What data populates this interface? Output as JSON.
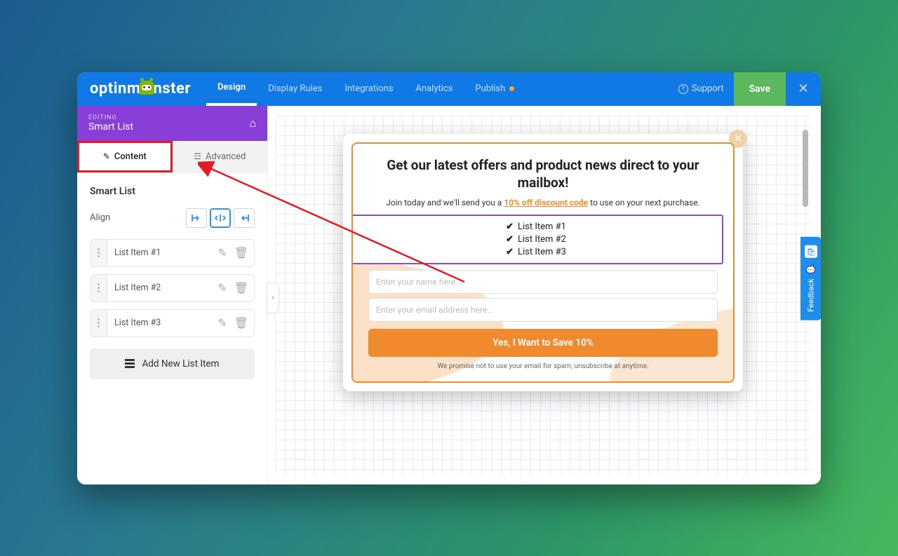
{
  "logo": {
    "prefix": "optinm",
    "suffix": "nster"
  },
  "nav": {
    "design": "Design",
    "display_rules": "Display Rules",
    "integrations": "Integrations",
    "analytics": "Analytics",
    "publish": "Publish"
  },
  "support_label": "Support",
  "save_label": "Save",
  "breadcrumb": {
    "section": "EDITING",
    "title": "Smart List"
  },
  "tabs": {
    "content": "Content",
    "advanced": "Advanced"
  },
  "panel": {
    "section_title": "Smart List",
    "align_label": "Align",
    "add_item": "Add New List Item",
    "items": [
      {
        "label": "List Item #1"
      },
      {
        "label": "List Item #2"
      },
      {
        "label": "List Item #3"
      }
    ]
  },
  "popup": {
    "headline": "Get our latest offers and product news direct to your mailbox!",
    "sub_before": "Join today and we'll send you a ",
    "sub_highlight": "10% off discount code",
    "sub_after": " to use on your next purchase.",
    "list": [
      "List Item #1",
      "List Item #2",
      "List Item #3"
    ],
    "name_placeholder": "Enter your name here...",
    "email_placeholder": "Enter your email address here...",
    "cta": "Yes, I Want to Save 10%",
    "disclaimer": "We promise not to use your email for spam, unsubscribe at anytime."
  },
  "feedback_label": "Feedback"
}
